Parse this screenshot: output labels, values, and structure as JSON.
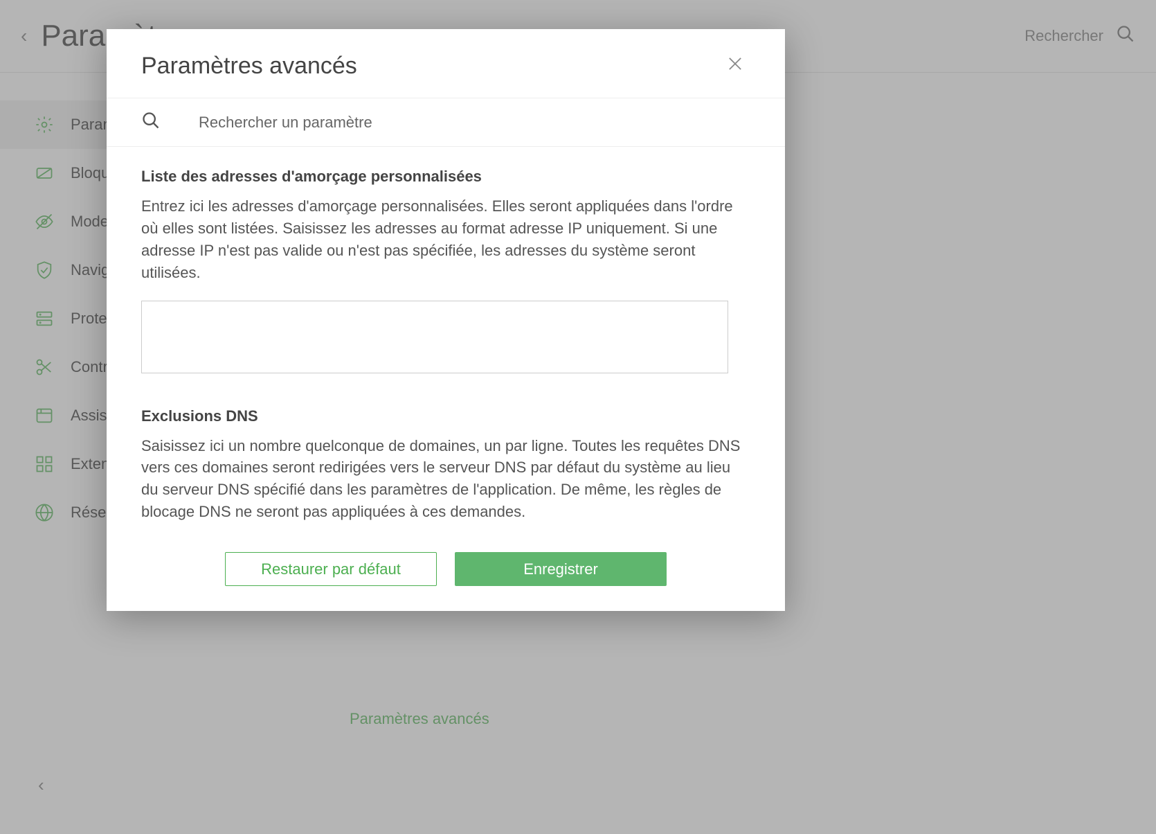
{
  "header": {
    "title": "Paramètres",
    "search_label": "Rechercher"
  },
  "sidebar": {
    "items": [
      {
        "label": "Paramètres"
      },
      {
        "label": "Bloqueur"
      },
      {
        "label": "Mode furtif"
      },
      {
        "label": "Navigation"
      },
      {
        "label": "Protection"
      },
      {
        "label": "Contrôle"
      },
      {
        "label": "Assistant"
      },
      {
        "label": "Extensions"
      },
      {
        "label": "Réseau"
      }
    ]
  },
  "content": {
    "advanced_link": "Paramètres avancés"
  },
  "dialog": {
    "title": "Paramètres avancés",
    "search_placeholder": "Rechercher un paramètre",
    "sections": [
      {
        "title": "Liste des adresses d'amorçage personnalisées",
        "description": "Entrez ici les adresses d'amorçage personnalisées. Elles seront appliquées dans l'ordre où elles sont listées. Saisissez les adresses au format adresse IP uniquement. Si une adresse IP n'est pas valide ou n'est pas spécifiée, les adresses du système seront utilisées.",
        "value": ""
      },
      {
        "title": "Exclusions DNS",
        "description": "Saisissez ici un nombre quelconque de domaines, un par ligne. Toutes les requêtes DNS vers ces domaines seront redirigées vers le serveur DNS par défaut du système au lieu du serveur DNS spécifié dans les paramètres de l'application. De même, les règles de blocage DNS ne seront pas appliquées à ces demandes."
      }
    ],
    "footer": {
      "restore": "Restaurer par défaut",
      "save": "Enregistrer"
    }
  }
}
